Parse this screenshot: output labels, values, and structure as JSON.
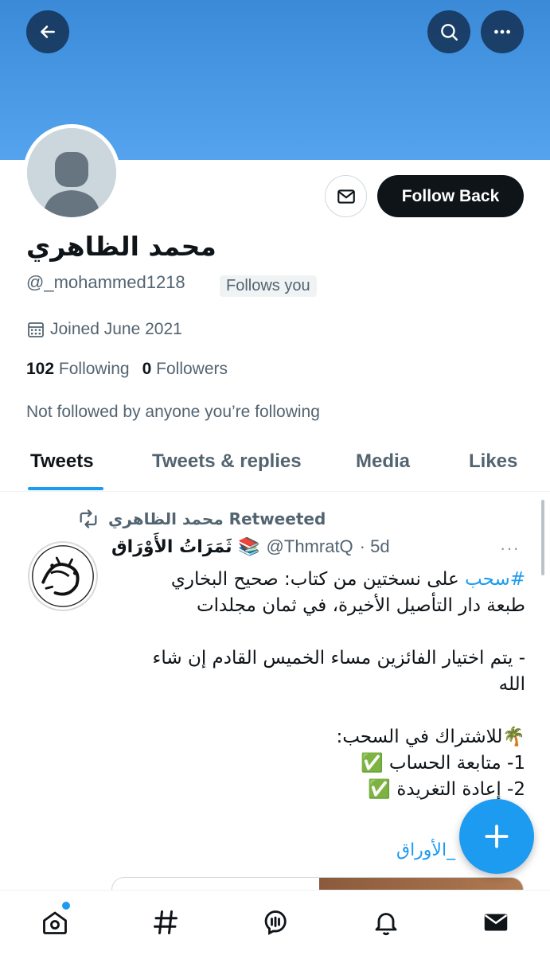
{
  "header": {
    "back_icon": "arrow-left-icon",
    "search_icon": "search-icon",
    "more_icon": "more-horizontal-icon",
    "banner_color": "#4a9ae6"
  },
  "profile": {
    "display_name": "محمد الظاهري",
    "handle": "@_mohammed1218",
    "follows_you": "Follows you",
    "joined": "Joined June 2021",
    "following_count": "102",
    "following_label": "Following",
    "followers_count": "0",
    "followers_label": "Followers",
    "not_followed": "Not followed by anyone you’re following",
    "follow_button": "Follow Back",
    "message_icon": "mail-icon"
  },
  "tabs": [
    {
      "label": "Tweets",
      "active": true
    },
    {
      "label": "Tweets & replies",
      "active": false
    },
    {
      "label": "Media",
      "active": false
    },
    {
      "label": "Likes",
      "active": false
    }
  ],
  "tweet": {
    "retweeted_by": "محمد الظاهري Retweeted",
    "author_name": "ثَمَرَاتُ الأَوْرَاق 📚",
    "author_handle": "@ThmratQ",
    "time": "· 5d",
    "more": "···",
    "body": {
      "hashtag": "#سحب",
      "line1_rest": " على نسختين من كتاب: صحيح البخاري",
      "line2": "طبعة دار التأصيل الأخيرة، في ثمان مجلدات",
      "line3": "- يتم اختيار الفائزين مساء الخميس القادم إن شاء",
      "line4": "الله",
      "line5": "🌴للاشتراك في السحب:",
      "line6": "1- متابعة الحساب ✅",
      "line7": "2- إعادة التغريدة ✅"
    },
    "link_text": "_الأوراق"
  },
  "compose_button": "compose-plus-icon",
  "bottom_nav": [
    {
      "icon": "home-icon",
      "has_dot": true
    },
    {
      "icon": "explore-hashtag-icon"
    },
    {
      "icon": "spaces-icon"
    },
    {
      "icon": "notifications-bell-icon"
    },
    {
      "icon": "messages-mail-icon",
      "active": true
    }
  ],
  "accent_color": "#1d9bf0"
}
